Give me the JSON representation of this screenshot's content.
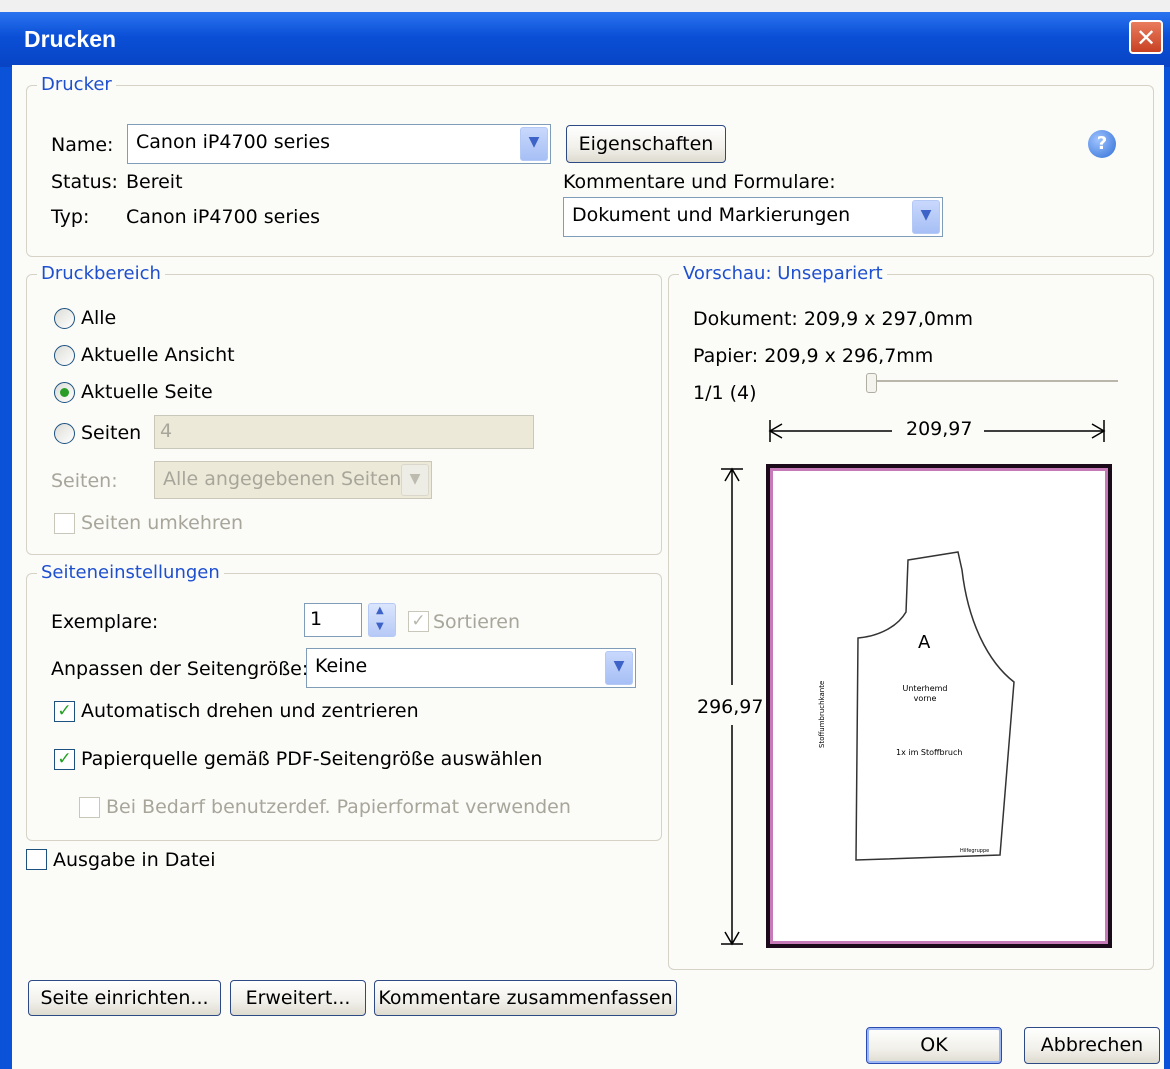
{
  "window": {
    "title": "Drucken",
    "close_symbol": "✕"
  },
  "printer": {
    "legend": "Drucker",
    "name_label": "Name:",
    "name_value": "Canon iP4700 series",
    "properties_button": "Eigenschaften",
    "status_label": "Status:",
    "status_value": "Bereit",
    "type_label": "Typ:",
    "type_value": "Canon iP4700 series",
    "comments_label": "Kommentare und Formulare:",
    "comments_value": "Dokument und Markierungen",
    "help_symbol": "?"
  },
  "range": {
    "legend": "Druckbereich",
    "options": [
      "Alle",
      "Aktuelle Ansicht",
      "Aktuelle Seite",
      "Seiten"
    ],
    "selected_index": 2,
    "pages_value": "4",
    "subset_label": "Seiten:",
    "subset_value": "Alle angegebenen Seiten",
    "reverse_label": "Seiten umkehren"
  },
  "page_settings": {
    "legend": "Seiteneinstellungen",
    "copies_label": "Exemplare:",
    "copies_value": "1",
    "collate_label": "Sortieren",
    "fit_label": "Anpassen der Seitengröße:",
    "fit_value": "Keine",
    "auto_rotate_label": "Automatisch drehen und zentrieren",
    "auto_rotate_checked": true,
    "paper_source_label": "Papierquelle gemäß PDF-Seitengröße auswählen",
    "paper_source_checked": true,
    "custom_paper_label": "Bei Bedarf benutzerdef. Papierformat verwenden",
    "custom_paper_checked": false
  },
  "output_to_file": {
    "label": "Ausgabe in Datei",
    "checked": false
  },
  "preview": {
    "legend": "Vorschau: Unsepariert",
    "document_size": "Dokument: 209,9 x 297,0mm",
    "paper_size": "Papier: 209,9 x 296,7mm",
    "page_counter": "1/1 (4)",
    "width_dim": "209,97",
    "height_dim": "296,97",
    "pattern_letter": "A",
    "pattern_text1": "Unterhemd\nvorne",
    "pattern_text2": "1x im Stoffbruch",
    "pattern_side": "Stoffumbruchkante",
    "pattern_small": "Hilfegruppe"
  },
  "buttons": {
    "page_setup": "Seite einrichten...",
    "advanced": "Erweitert...",
    "summarize_comments": "Kommentare zusammenfassen",
    "ok": "OK",
    "cancel": "Abbrechen"
  },
  "colors": {
    "title_bar": "#0a53d8",
    "legend_text": "#1e4fcf",
    "page_border": "#1a0a1a",
    "page_inner_border": "#c77ab8"
  }
}
